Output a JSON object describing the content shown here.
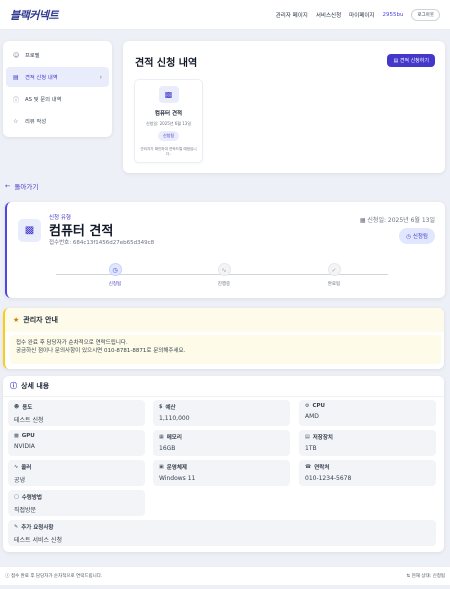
{
  "header": {
    "logo": "블랙커넥트",
    "logo_sub": "",
    "nav": [
      "관리자 페이지",
      "서비스신청",
      "마이페이지"
    ],
    "user": "2955bu",
    "logout": "로그아웃"
  },
  "sidebar": {
    "items": [
      {
        "label": "프로필",
        "icon": "user-icon"
      },
      {
        "label": "견적 신청 내역",
        "icon": "document-icon",
        "active": true
      },
      {
        "label": "AS 및 문의 내역",
        "icon": "help-icon"
      },
      {
        "label": "리뷰 작성",
        "icon": "star-icon"
      }
    ]
  },
  "history": {
    "title": "견적 신청 내역",
    "new_button": "견적 신청하기",
    "card": {
      "title": "컴퓨터 견적",
      "date": "신청일: 2025년 6월 13일",
      "status": "신청됨",
      "message": "관리자가 확인하여 연락드릴 예정입니다."
    }
  },
  "back": "돌아가기",
  "request": {
    "type_label": "신청 유형",
    "title": "컴퓨터 견적",
    "receipt": "접수번호: 684c13f1456d27eb65d349c8",
    "date": "신청일: 2025년 6월 13일",
    "status": "신청됨",
    "steps": [
      "신청됨",
      "진행중",
      "완료됨"
    ],
    "current_step": 0
  },
  "notice": {
    "title": "관리자 안내",
    "line1": "접수 완료 후 담당자가 순차적으로 연락드립니다.",
    "line2": "궁금하신 점이나 문의사항이 있으시면 010-8781-8871로 문의해주세요."
  },
  "detail": {
    "title": "상세 내용",
    "fields": [
      {
        "label": "용도",
        "value": "테스트 신청",
        "icon": "users-icon"
      },
      {
        "label": "예산",
        "value": "1,110,000",
        "icon": "dollar-icon"
      },
      {
        "label": "CPU",
        "value": "AMD",
        "icon": "cpu-icon"
      },
      {
        "label": "GPU",
        "value": "NVIDIA",
        "icon": "monitor-icon"
      },
      {
        "label": "메모리",
        "value": "16GB",
        "icon": "memory-icon"
      },
      {
        "label": "저장장치",
        "value": "1TB",
        "icon": "storage-icon"
      },
      {
        "label": "쿨러",
        "value": "공냉",
        "icon": "fan-icon"
      },
      {
        "label": "운영체제",
        "value": "Windows 11",
        "icon": "os-icon"
      },
      {
        "label": "연락처",
        "value": "010-1234-5678",
        "icon": "phone-icon"
      },
      {
        "label": "수령방법",
        "value": "직접방문",
        "icon": "box-icon"
      },
      {
        "label": "추가 요청사항",
        "value": "테스트 서비스 신청",
        "icon": "note-icon"
      }
    ]
  },
  "footer": {
    "left": "접수 완료 후 담당자가 순차적으로 연락드립니다.",
    "right": "현재 상태: 신청됨"
  }
}
